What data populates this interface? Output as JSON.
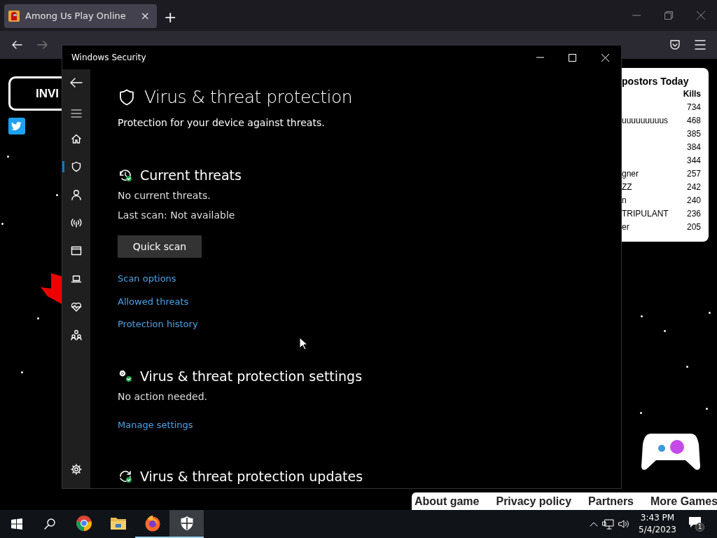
{
  "browser": {
    "tab_title": "Among Us Play Online",
    "tab_close": "×",
    "new_tab": "+"
  },
  "page": {
    "invite_button": "INVI",
    "leaderboard": {
      "title": "postors Today",
      "kills_header": "Kills",
      "rows": [
        {
          "kills": "734"
        },
        {
          "name": "uuuuuuuuus",
          "kills": "468"
        },
        {
          "kills": "385"
        },
        {
          "kills": "384"
        },
        {
          "kills": "344"
        },
        {
          "name": "gner",
          "kills": "257"
        },
        {
          "name": "ZZ",
          "kills": "242"
        },
        {
          "name": "n",
          "kills": "240"
        },
        {
          "name": "TRIPULANT",
          "kills": "236"
        },
        {
          "name": "er",
          "kills": "205"
        }
      ]
    },
    "footer_links": [
      "About game",
      "Privacy policy",
      "Partners",
      "More Games"
    ]
  },
  "window": {
    "title": "Windows Security",
    "sidebar": [
      {
        "kind": "home",
        "selected": false
      },
      {
        "kind": "shield",
        "selected": true
      },
      {
        "kind": "person",
        "selected": false
      },
      {
        "kind": "wireless",
        "selected": false
      },
      {
        "kind": "browser",
        "selected": false
      },
      {
        "kind": "laptop",
        "selected": false
      },
      {
        "kind": "health",
        "selected": false
      },
      {
        "kind": "family",
        "selected": false
      }
    ],
    "heading": "Virus & threat protection",
    "subtitle": "Protection for your device against threats.",
    "sections": [
      {
        "kind": "threats",
        "title": "Current threats",
        "lines": [
          "No current threats.",
          "Last scan: Not available"
        ],
        "button": "Quick scan",
        "links": [
          "Scan options",
          "Allowed threats",
          "Protection history"
        ]
      },
      {
        "kind": "settings",
        "title": "Virus & threat protection settings",
        "lines": [
          "No action needed."
        ],
        "links": [
          "Manage settings"
        ]
      },
      {
        "kind": "updates",
        "title": "Virus & threat protection updates"
      }
    ]
  },
  "taskbar": {
    "apps": [
      {
        "kind": "chrome",
        "selected": false,
        "running": false
      },
      {
        "kind": "folder",
        "selected": false,
        "running": false
      },
      {
        "kind": "firefox",
        "selected": false,
        "running": true
      },
      {
        "kind": "security",
        "selected": true,
        "running": true
      }
    ],
    "time": "3:43 PM",
    "date": "5/4/2023",
    "notifications": "1"
  }
}
